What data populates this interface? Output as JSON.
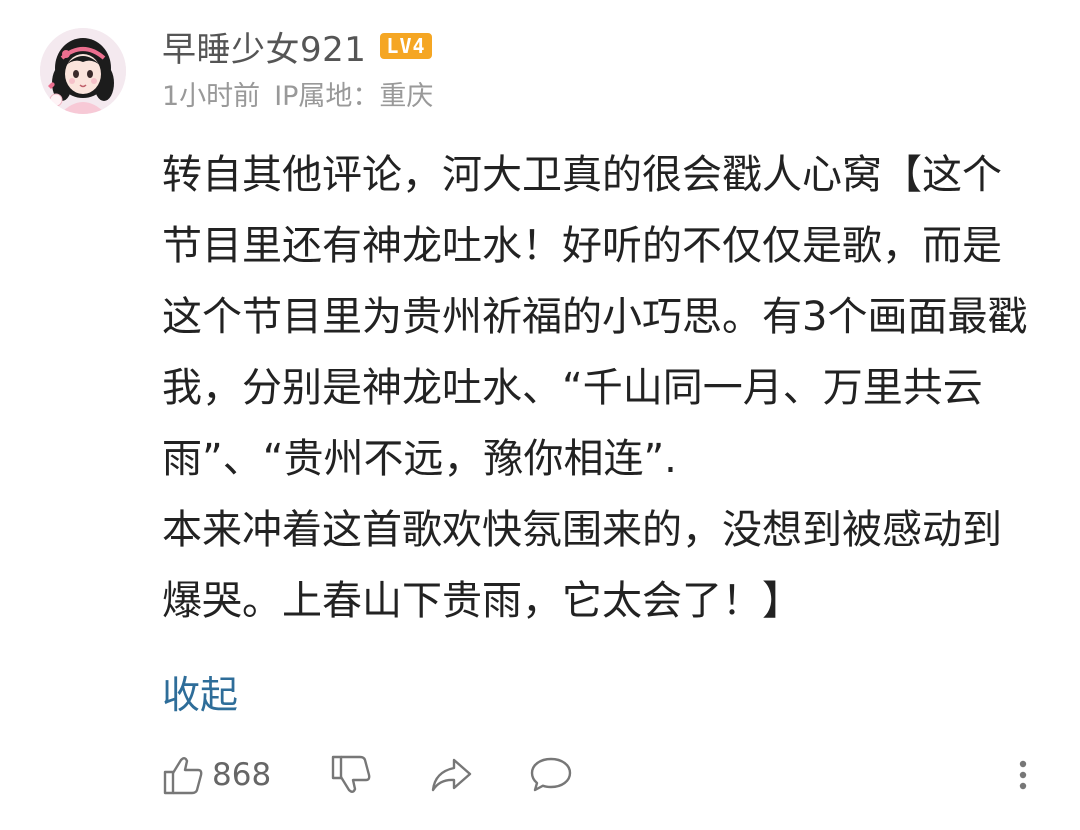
{
  "user": {
    "name": "早睡少女921",
    "level": "LV4",
    "time": "1小时前",
    "ip_location": "IP属地：重庆"
  },
  "comment": {
    "text": "转自其他评论，河大卫真的很会戳人心窝【这个节目里还有神龙吐水！好听的不仅仅是歌，而是这个节目里为贵州祈福的小巧思。有3个画面最戳我，分别是神龙吐水、“千山同一月、万里共云雨”、“贵州不远，豫你相连”.",
    "text_2": "本来冲着这首歌欢快氛围来的，没想到被感动到爆哭。上春山下贵雨，它太会了！】",
    "collapse_label": "收起"
  },
  "actions": {
    "like_count": "868",
    "like_icon": "thumbs-up-icon",
    "dislike_icon": "thumbs-down-icon",
    "share_icon": "share-arrow-icon",
    "reply_icon": "speech-bubble-icon",
    "more_icon": "vertical-ellipsis-icon"
  },
  "colors": {
    "link": "#2e6d99",
    "badge": "#f5a623",
    "meta": "#999999",
    "text": "#222222"
  }
}
